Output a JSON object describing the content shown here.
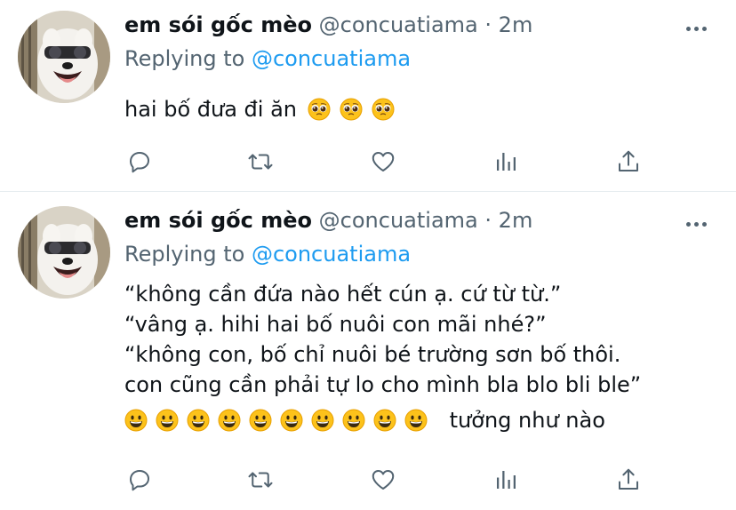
{
  "tweets": [
    {
      "name": "em sói gốc mèo",
      "handle": "@concuatiama",
      "separator": "·",
      "time": "2m",
      "replying_prefix": "Replying to",
      "replying_to": "@concuatiama",
      "text": "hai bố đưa đi ăn",
      "text_emojis": [
        "pleading-face-emoji",
        "pleading-face-emoji",
        "pleading-face-emoji"
      ]
    },
    {
      "name": "em sói gốc mèo",
      "handle": "@concuatiama",
      "separator": "·",
      "time": "2m",
      "replying_prefix": "Replying to",
      "replying_to": "@concuatiama",
      "lines": [
        "“không cần đứa nào hết cún ạ. cứ từ từ.”",
        "“vâng ạ. hihi hai bố nuôi con mãi nhé?”",
        "“không con, bố chỉ nuôi bé trường sơn bố thôi.",
        "con cũng cần phải tự lo cho mình bla blo bli ble”"
      ],
      "emoji_row_count": 10,
      "emoji_row_icon": "grinning-face-emoji",
      "emoji_row_tail": "tưởng như nào"
    }
  ],
  "actions": [
    "reply-icon",
    "retweet-icon",
    "like-icon",
    "analytics-icon",
    "share-icon"
  ],
  "colors": {
    "text": "#0f1419",
    "secondary": "#536471",
    "link": "#1d9bf0",
    "divider": "#e6ecf0"
  }
}
